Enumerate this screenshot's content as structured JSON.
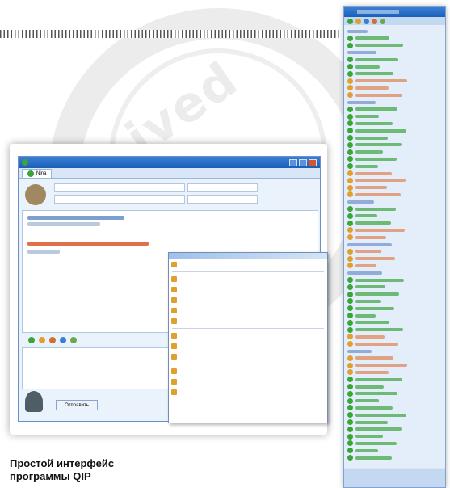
{
  "caption": {
    "line1": "Простой интерфейс",
    "line2": "программы QIP"
  },
  "chat_window": {
    "tab_label": "Nina",
    "send_button": "Отправить"
  },
  "colors": {
    "window_title": "#1b5fb8",
    "contact_online": "#3ba43b",
    "message_outgoing": "#e0704a"
  },
  "icons": [
    "qip-flower-icon",
    "contact-avatar",
    "menu-item-icon",
    "status-online-icon"
  ]
}
